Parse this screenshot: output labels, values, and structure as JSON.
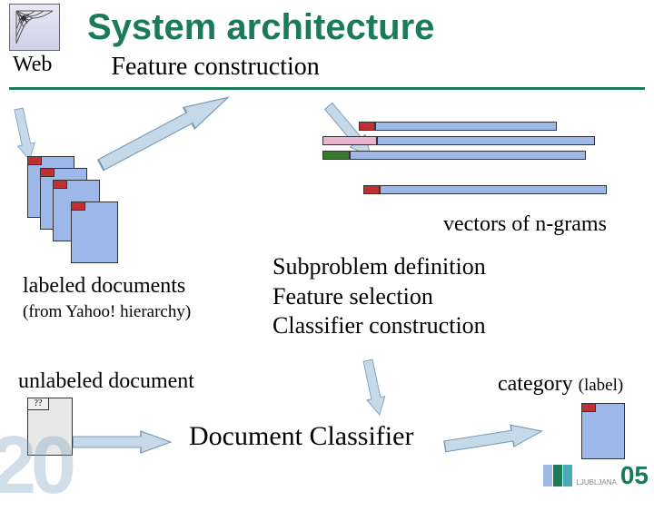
{
  "title": "System architecture",
  "spider_icon": "web-icon",
  "web_label": "Web",
  "feature_construction": "Feature construction",
  "vectors_label": "vectors of n-grams",
  "labeled_docs": "labeled documents",
  "labeled_source": "(from Yahoo! hierarchy)",
  "subproblem": {
    "line1": "Subproblem definition",
    "line2": "Feature selection",
    "line3": "Classifier construction"
  },
  "unlabeled_label": "unlabeled document",
  "classifier_label": "Document Classifier",
  "category": "category",
  "category_sub": "(label)",
  "unknown_tag": "??",
  "page_number": "20",
  "footer_mark": "LJUBLJANA",
  "footer_num": "05",
  "colors": {
    "accent": "#1a7a5a",
    "arrow_fill": "#c5d9e8",
    "doc_fill": "#9db8e8",
    "red": "#c03030"
  }
}
